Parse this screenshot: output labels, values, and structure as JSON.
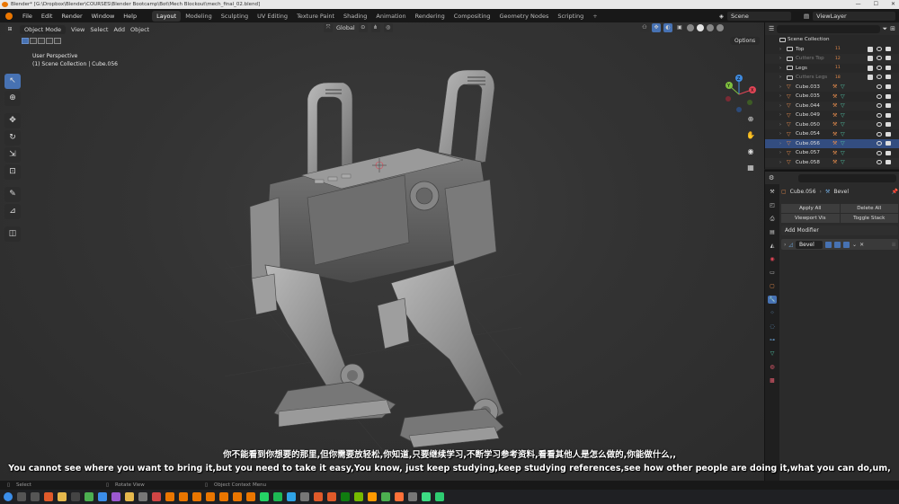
{
  "window": {
    "title": "Blender* [G:\\Dropbox\\Blender\\COURSES\\Blender Bootcamp\\Bot\\Mech Blockout\\mech_final_02.blend]",
    "controls": [
      "—",
      "☐",
      "✕"
    ]
  },
  "menubar": {
    "menus": [
      "File",
      "Edit",
      "Render",
      "Window",
      "Help"
    ],
    "workspaces": [
      "Layout",
      "Modeling",
      "Sculpting",
      "UV Editing",
      "Texture Paint",
      "Shading",
      "Animation",
      "Rendering",
      "Compositing",
      "Geometry Nodes",
      "Scripting"
    ],
    "active_workspace": "Layout",
    "add_tab": "+",
    "scene": "Scene",
    "view_layer": "ViewLayer"
  },
  "viewport": {
    "mode": "Object Mode",
    "menus": [
      "View",
      "Select",
      "Add",
      "Object"
    ],
    "transform_orientation": "Global",
    "options": "Options",
    "info_line1": "User Perspective",
    "info_line2": "(1) Scene Collection | Cube.056",
    "gizmo_labels": {
      "x": "X",
      "y": "Y",
      "z": "Z"
    }
  },
  "outliner": {
    "search_placeholder": "",
    "root": "Scene Collection",
    "collections": [
      {
        "name": "Top",
        "count": "11",
        "dim": false
      },
      {
        "name": "Cutters Top",
        "count": "12",
        "dim": true
      },
      {
        "name": "Legs",
        "count": "11",
        "dim": false
      },
      {
        "name": "Cutters Legs",
        "count": "18",
        "dim": true
      }
    ],
    "objects": [
      "Cube.033",
      "Cube.035",
      "Cube.044",
      "Cube.049",
      "Cube.050",
      "Cube.054",
      "Cube.056",
      "Cube.057",
      "Cube.058"
    ],
    "selected_object": "Cube.056"
  },
  "properties": {
    "object": "Cube.056",
    "modifier_ref": "Bevel",
    "apply_all": "Apply All",
    "delete_all": "Delete All",
    "viewport_vis": "Viewport Vis",
    "toggle_stack": "Toggle Stack",
    "add_modifier": "Add Modifier",
    "modifier_name": "Bevel"
  },
  "statusbar": {
    "select": "Select",
    "rotate_view": "Rotate View",
    "context_menu": "Object Context Menu"
  },
  "subtitles": {
    "zh": "你不能看到你想要的那里,但你需要放轻松,你知道,只要继续学习,不断学习参考资料,看看其他人是怎么做的,你能做什么,,",
    "en": "You cannot see where you want to bring it,but you need to take it easy,You know, just keep studying,keep studying references,see how other people are doing it,what you can do,um,"
  },
  "colors": {
    "accent": "#4772b3",
    "blender_orange": "#ea7600",
    "selected_row": "#334d80",
    "axis_x": "#e04556",
    "axis_y": "#7fbf3f",
    "axis_z": "#3f8be0"
  },
  "taskbar_apps": [
    "start",
    "search",
    "taskview",
    "brave",
    "folder",
    "obs",
    "chrome",
    "photos",
    "premiere",
    "files",
    "settings",
    "media",
    "blender1",
    "blender2",
    "blender3",
    "blender4",
    "blender5",
    "blender6",
    "blender7",
    "whatsapp",
    "spotify",
    "photoshop",
    "mixer",
    "brave2",
    "brave3",
    "xbox",
    "nvidia",
    "illustrator",
    "chrome2",
    "firefox",
    "store",
    "android",
    "camtasia"
  ]
}
